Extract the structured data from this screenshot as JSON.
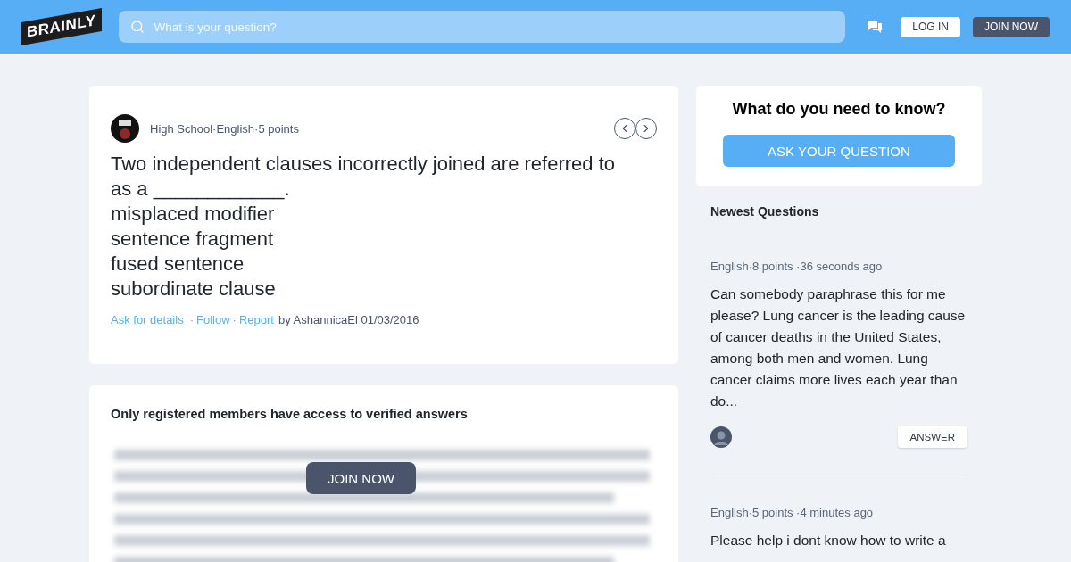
{
  "header": {
    "logo": "BRAINLY",
    "search": {
      "placeholder": "What is your question?"
    },
    "login": "LOG IN",
    "join": "JOIN NOW"
  },
  "question": {
    "meta": "High School·English·5 points",
    "text": "Two independent clauses incorrectly joined are referred to as a ____________.\nmisplaced modifier\nsentence fragment\nfused sentence\nsubordinate clause",
    "actions": [
      "Ask for details",
      "Follow",
      "Report"
    ],
    "separator": "·",
    "author": "by AshannicaEl 01/03/2016"
  },
  "answers": {
    "title": "Only registered members have access to verified answers",
    "join": "JOIN NOW"
  },
  "ask": {
    "title": "What do you need to know?",
    "button": "ASK YOUR QUESTION"
  },
  "newest": {
    "title": "Newest Questions",
    "items": [
      {
        "meta": "English·8 points ·36 seconds ago",
        "text": "Can somebody paraphrase this for me please? Lung cancer is the leading cause of cancer deaths in the United States, among both men and women. Lung cancer claims more lives each year than do...",
        "button": "ANSWER"
      },
      {
        "meta": "English·5 points ·4 minutes ago",
        "text": "Please help i dont know how to write a"
      }
    ]
  }
}
